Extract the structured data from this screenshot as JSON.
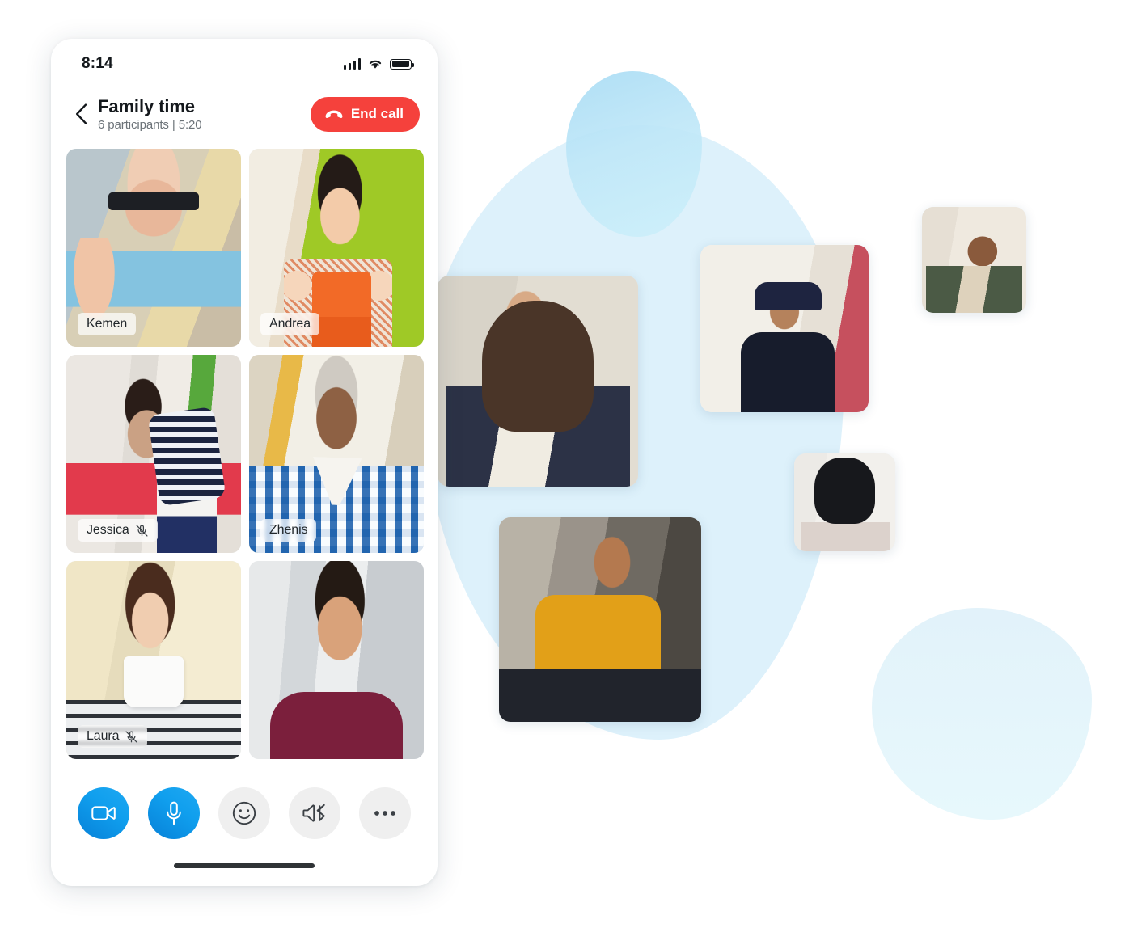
{
  "phone": {
    "status_bar": {
      "time": "8:14",
      "icons": [
        "signal-bars-icon",
        "wifi-icon",
        "battery-icon"
      ]
    },
    "header": {
      "back_icon": "chevron-left-icon",
      "title": "Family time",
      "subtitle": "6 participants | 5:20",
      "end_call": {
        "label": "End call",
        "icon": "end-call-handset-icon",
        "color": "#F5413C"
      }
    },
    "grid": {
      "participants": [
        {
          "name": "Kemen",
          "muted": false,
          "photo": "ph-kemen",
          "alt": "older man with glasses waving in a workshop"
        },
        {
          "name": "Andrea",
          "muted": false,
          "photo": "ph-andrea",
          "alt": "child with hands cupped to ears against a green wall"
        },
        {
          "name": "Jessica",
          "muted": true,
          "photo": "ph-jessica",
          "alt": "children playing upside down by a red couch"
        },
        {
          "name": "Zhenis",
          "muted": false,
          "photo": "ph-zhenis",
          "alt": "smiling man in a blue plaid shirt"
        },
        {
          "name": "Laura",
          "muted": true,
          "photo": "ph-laura",
          "alt": "woman holding a mug with a mustache design"
        },
        {
          "name": "",
          "muted": false,
          "photo": "ph-javier",
          "alt": "smiling man in a maroon polo shirt"
        }
      ]
    },
    "toolbar": {
      "buttons": [
        {
          "name": "video-camera-button",
          "icon": "video-camera-icon",
          "style": "primary"
        },
        {
          "name": "microphone-button",
          "icon": "microphone-icon",
          "style": "primary"
        },
        {
          "name": "reactions-button",
          "icon": "smiley-face-icon",
          "style": "secondary"
        },
        {
          "name": "audio-output-button",
          "icon": "speaker-bluetooth-icon",
          "style": "secondary"
        },
        {
          "name": "more-options-button",
          "icon": "ellipsis-icon",
          "style": "secondary"
        }
      ]
    },
    "home_indicator": true
  },
  "decoration": {
    "blobs": [
      {
        "name": "blob-large",
        "color": "#DDF1FB"
      },
      {
        "name": "blob-mid",
        "color": "#A9DCF4"
      },
      {
        "name": "blob-small",
        "color": "#E2F2FA"
      }
    ],
    "photo_cards": [
      {
        "name": "card-beard",
        "photo": "ph-beard",
        "alt": "laughing man with long hair and beard"
      },
      {
        "name": "card-hat",
        "photo": "ph-hat",
        "alt": "woman in a navy hat working on a laptop"
      },
      {
        "name": "card-short",
        "photo": "ph-short",
        "alt": "person with short hair in a green blazer"
      },
      {
        "name": "card-dark",
        "photo": "ph-dark",
        "alt": "woman with dark bobbed hair looking down"
      },
      {
        "name": "card-yellow",
        "photo": "ph-yellow",
        "alt": "woman in a yellow shirt with a coffee cup"
      }
    ]
  },
  "theme": {
    "accent_blue": "#0781D8",
    "accent_blue_light": "#1FA8F1",
    "end_call_red": "#F5413C",
    "text_primary": "#14181C",
    "text_secondary": "#6B7278",
    "button_grey": "#EFEFEF"
  }
}
